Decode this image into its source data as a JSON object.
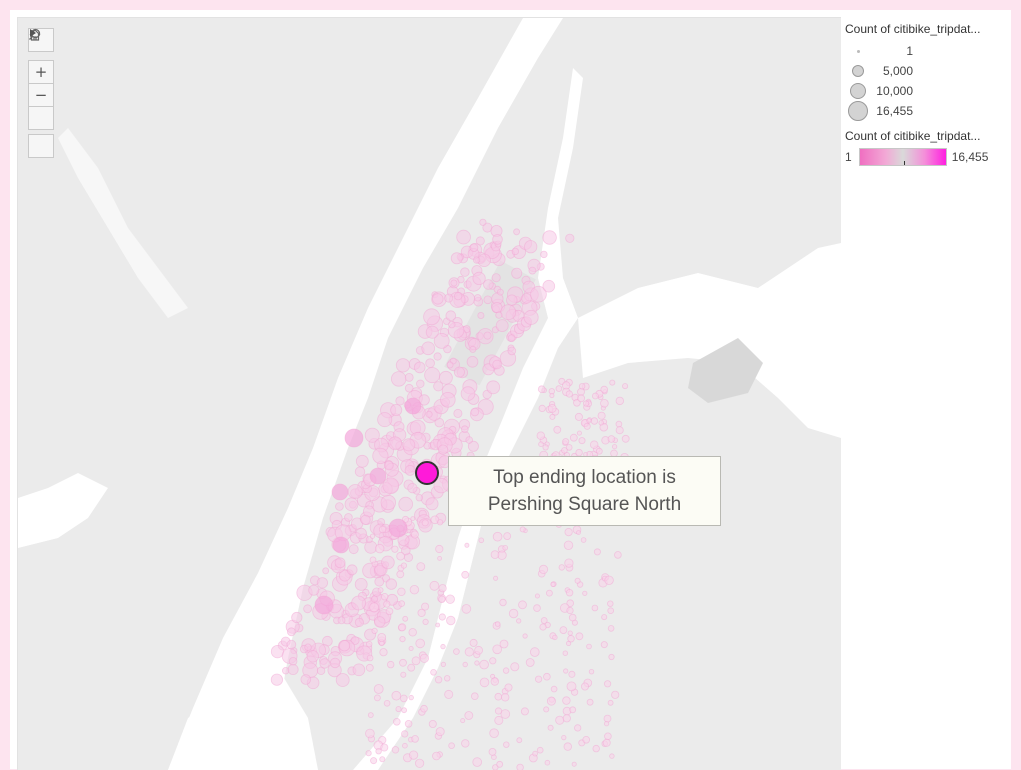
{
  "map": {
    "toolbar": {
      "search_icon": "search-icon",
      "zoom_in": "+",
      "zoom_out": "−",
      "home_icon": "home-icon",
      "play_icon": "play-icon"
    },
    "annotation": {
      "line1": "Top ending location is",
      "line2": "Pershing Square North"
    },
    "highlight_color": "#ff1ad9",
    "point_color": "#f5c3e4",
    "water_color": "#ffffff",
    "land_color": "#ebebeb"
  },
  "legend": {
    "size": {
      "title": "Count of citibike_tripdat...",
      "entries": [
        "1",
        "5,000",
        "10,000",
        "16,455"
      ]
    },
    "color": {
      "title": "Count of citibike_tripdat...",
      "min_label": "1",
      "max_label": "16,455",
      "colors": [
        "#f06fc1",
        "#d9d9d9",
        "#ff1fe0"
      ]
    }
  }
}
